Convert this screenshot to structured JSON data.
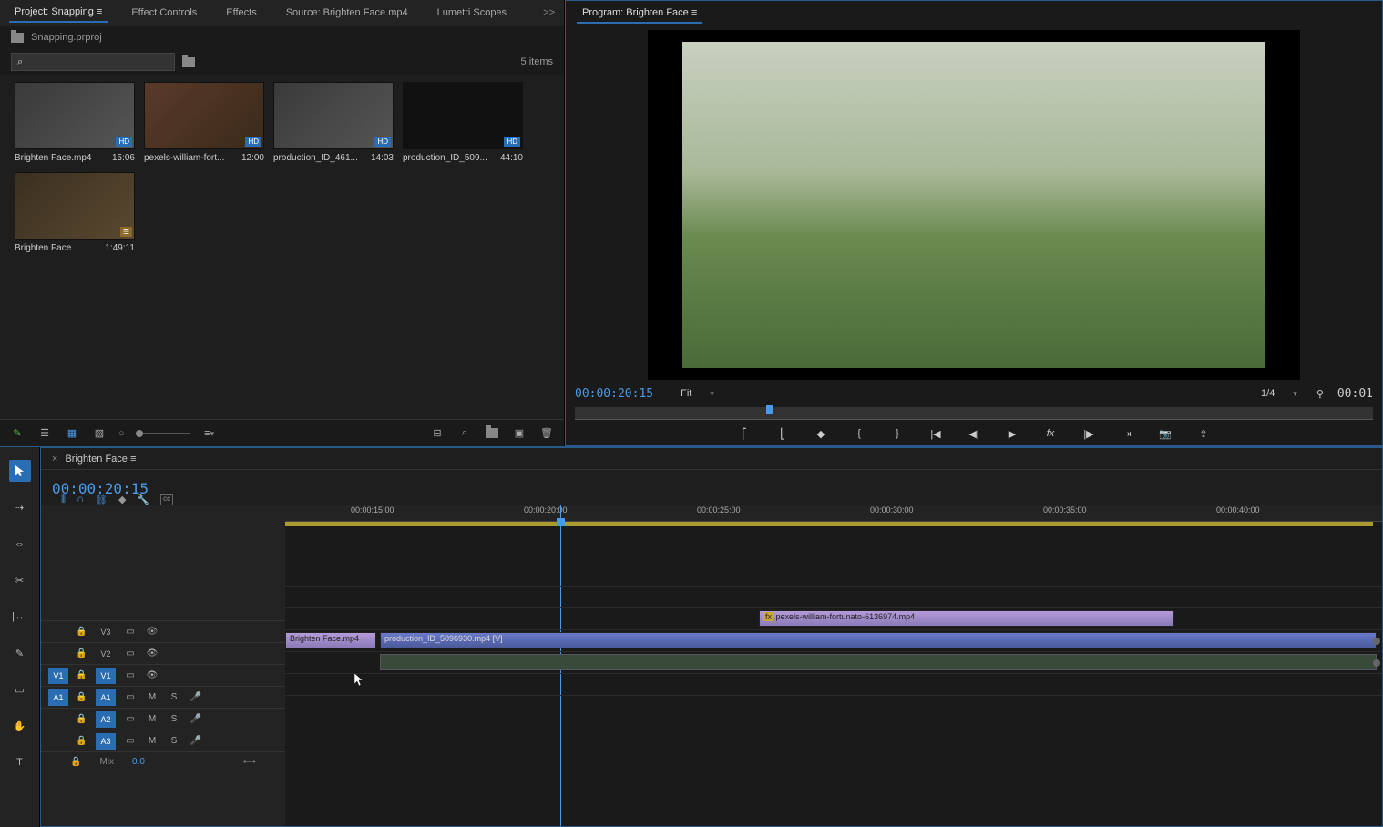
{
  "tabs_left": {
    "project": "Project: Snapping",
    "effect_controls": "Effect Controls",
    "effects": "Effects",
    "source": "Source: Brighten Face.mp4",
    "lumetri": "Lumetri Scopes",
    "more": ">>"
  },
  "program_tab": "Program: Brighten Face",
  "project": {
    "name": "Snapping.prproj",
    "item_count": "5 items"
  },
  "bins": [
    {
      "name": "Brighten Face.mp4",
      "dur": "15:06"
    },
    {
      "name": "pexels-william-fort...",
      "dur": "12:00"
    },
    {
      "name": "production_ID_461...",
      "dur": "14:03"
    },
    {
      "name": "production_ID_509...",
      "dur": "44:10"
    },
    {
      "name": "Brighten Face",
      "dur": "1:49:11"
    }
  ],
  "program": {
    "tc": "00:00:20:15",
    "fit": "Fit",
    "res": "1/4",
    "dur": "00:01"
  },
  "sequence": {
    "name": "Brighten Face",
    "tc": "00:00:20:15"
  },
  "ruler": [
    "00:00:15:00",
    "00:00:20:00",
    "00:00:25:00",
    "00:00:30:00",
    "00:00:35:00",
    "00:00:40:00"
  ],
  "tracks": {
    "v3": "V3",
    "v2": "V2",
    "v1": "V1",
    "a1": "A1",
    "a2": "A2",
    "a3": "A3",
    "m": "M",
    "s": "S",
    "mix": "Mix",
    "mix_val": "0.0"
  },
  "clips": {
    "v2_fx": "pexels-william-fortunato-6136974.mp4",
    "v1_a": "Brighten Face.mp4",
    "v1_b": "production_ID_5096930.mp4 [V]"
  }
}
